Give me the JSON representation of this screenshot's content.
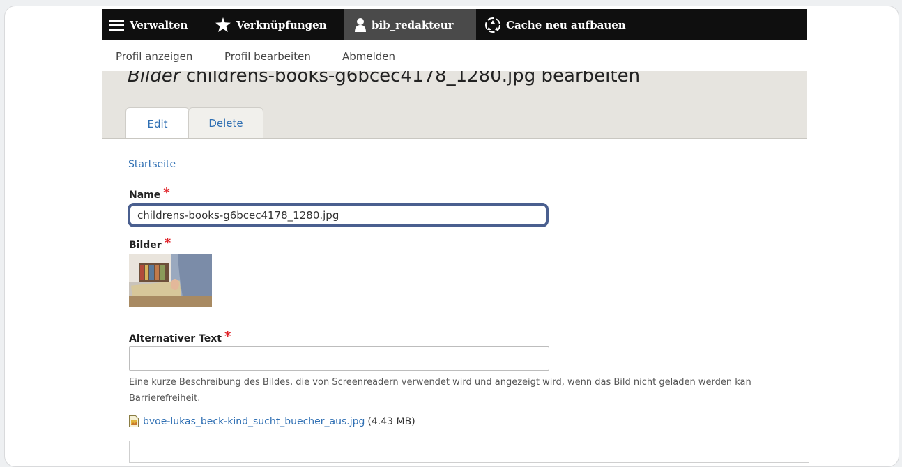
{
  "toolbar": {
    "items": [
      {
        "label": "Verwalten",
        "icon": "menu-icon"
      },
      {
        "label": "Verknüpfungen",
        "icon": "star-icon"
      },
      {
        "label": "bib_redakteur",
        "icon": "user-icon"
      },
      {
        "label": "Cache neu aufbauen",
        "icon": "recycle-icon"
      }
    ]
  },
  "subbar": {
    "links": [
      "Profil anzeigen",
      "Profil bearbeiten",
      "Abmelden"
    ]
  },
  "page": {
    "title_em": "Bilder",
    "title_rest": " childrens-books-g6bcec4178_1280.jpg bearbeiten",
    "tabs": [
      "Edit",
      "Delete"
    ]
  },
  "breadcrumb": "Startseite",
  "form": {
    "name_label": "Name",
    "name_value": "childrens-books-g6bcec4178_1280.jpg",
    "bilder_label": "Bilder",
    "alt_label": "Alternativer Text",
    "alt_value": "",
    "alt_description_line1": "Eine kurze Beschreibung des Bildes, die von Screenreadern verwendet wird und angezeigt wird, wenn das Bild nicht geladen werden kan",
    "alt_description_line2": "Barrierefreiheit.",
    "file_name": "bvoe-lukas_beck-kind_sucht_buecher_aus.jpg",
    "file_size": "(4.43 MB)"
  },
  "colors": {
    "toolbar_bg": "#0f0f0f",
    "link": "#2f6fb3",
    "required": "#e0242a",
    "focus_border": "#4a5f8f"
  }
}
